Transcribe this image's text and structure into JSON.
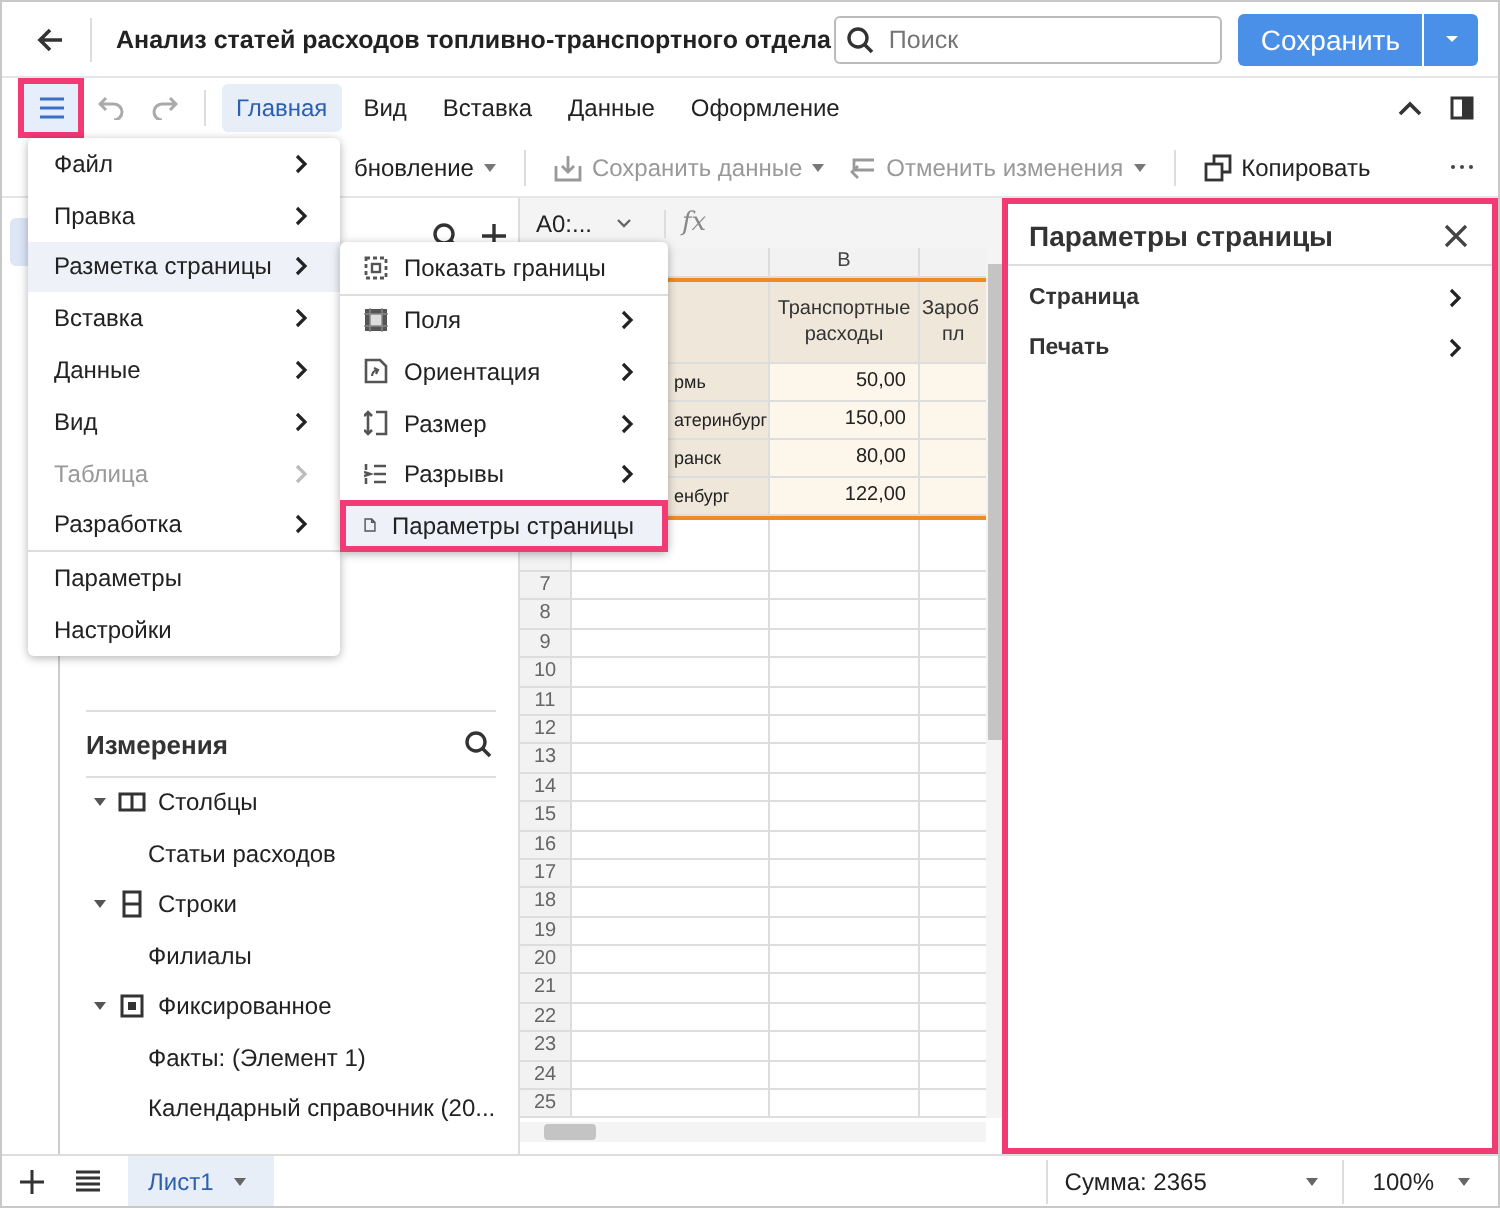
{
  "header": {
    "title": "Анализ статей расходов топливно-транспортного отдела",
    "search": {
      "placeholder": "Поиск"
    },
    "save_button": "Сохранить"
  },
  "ribbon": {
    "menu_button": {
      "highlighted": true
    },
    "tabs": [
      {
        "label": "Главная",
        "selected": true
      },
      {
        "label": "Вид",
        "selected": false
      },
      {
        "label": "Вставка",
        "selected": false
      },
      {
        "label": "Данные",
        "selected": false
      },
      {
        "label": "Оформление",
        "selected": false
      }
    ]
  },
  "toolbar": [
    {
      "label": "бновление",
      "disabled": false,
      "dropdown": true
    },
    {
      "label": "Сохранить данные",
      "disabled": true,
      "dropdown": true
    },
    {
      "label": "Отменить изменения",
      "disabled": true,
      "dropdown": true
    },
    {
      "label": "Копировать",
      "disabled": false,
      "dropdown": false
    }
  ],
  "main_menu": [
    {
      "label": "Файл",
      "submenu": true,
      "selected": false,
      "disabled": false
    },
    {
      "label": "Правка",
      "submenu": true,
      "selected": false,
      "disabled": false
    },
    {
      "label": "Разметка страницы",
      "submenu": true,
      "selected": true,
      "disabled": false
    },
    {
      "label": "Вставка",
      "submenu": true,
      "selected": false,
      "disabled": false
    },
    {
      "label": "Данные",
      "submenu": true,
      "selected": false,
      "disabled": false
    },
    {
      "label": "Вид",
      "submenu": true,
      "selected": false,
      "disabled": false
    },
    {
      "label": "Таблица",
      "submenu": true,
      "selected": false,
      "disabled": true
    },
    {
      "label": "Разработка",
      "submenu": true,
      "selected": false,
      "disabled": false
    },
    {
      "label": "Параметры",
      "submenu": false,
      "selected": false,
      "disabled": false
    },
    {
      "label": "Настройки",
      "submenu": false,
      "selected": false,
      "disabled": false
    }
  ],
  "submenu": [
    {
      "label": "Показать границы",
      "submenu": false,
      "selected": false,
      "highlighted": false
    },
    {
      "label": "Поля",
      "submenu": true,
      "selected": false,
      "highlighted": false
    },
    {
      "label": "Ориентация",
      "submenu": true,
      "selected": false,
      "highlighted": false
    },
    {
      "label": "Размер",
      "submenu": true,
      "selected": false,
      "highlighted": false
    },
    {
      "label": "Разрывы",
      "submenu": true,
      "selected": false,
      "highlighted": false
    },
    {
      "label": "Параметры страницы",
      "submenu": false,
      "selected": true,
      "highlighted": true
    }
  ],
  "dimensions": {
    "title": "Измерения",
    "items": [
      {
        "label": "Столбцы",
        "expanded": true,
        "children": [
          {
            "label": "Статьи расходов"
          }
        ]
      },
      {
        "label": "Строки",
        "expanded": true,
        "children": [
          {
            "label": "Филиалы"
          }
        ]
      },
      {
        "label": "Фиксированное",
        "expanded": true,
        "children": [
          {
            "label": "Факты: (Элемент 1)"
          },
          {
            "label": "Календарный справочник (20..."
          }
        ]
      }
    ]
  },
  "sheet": {
    "name_box": "A0:...",
    "formula_label": "fx",
    "column_headers": [
      "B"
    ],
    "table_header": {
      "column_b": "Транспортные расходы",
      "column_c": [
        "Зароб",
        "пл"
      ]
    },
    "rows": [
      {
        "column_a": "рмь",
        "column_b": "50,00"
      },
      {
        "column_a": "атеринбург",
        "column_b": "150,00"
      },
      {
        "column_a": "ранск",
        "column_b": "80,00"
      },
      {
        "column_a": "енбург",
        "column_b": "122,00"
      }
    ],
    "row_numbers": [
      "7",
      "8",
      "9",
      "10",
      "11",
      "12",
      "13",
      "14",
      "15",
      "16",
      "17",
      "18",
      "19",
      "20",
      "21",
      "22",
      "23",
      "24",
      "25"
    ]
  },
  "page_settings_panel": {
    "title": "Параметры страницы",
    "highlighted": true,
    "items": [
      {
        "label": "Страница"
      },
      {
        "label": "Печать"
      }
    ]
  },
  "status_bar": {
    "sheet_tabs": [
      {
        "label": "Лист1",
        "selected": true
      }
    ],
    "sum": "Сумма: 2365",
    "zoom": "100%"
  }
}
